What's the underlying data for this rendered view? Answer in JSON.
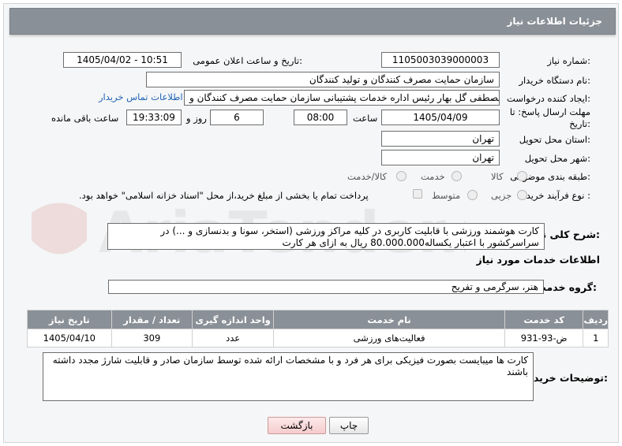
{
  "header": {
    "title": "جزئیات اطلاعات نیاز"
  },
  "form": {
    "need_number_label": "شماره نیاز:",
    "need_number": "1105003039000003",
    "announce_label": "تاریخ و ساعت اعلان عمومی:",
    "announce_value": "1405/04/02 - 10:51",
    "buyer_org_label": "نام دستگاه خریدار:",
    "buyer_org": "سازمان حمایت مصرف کنندگان و تولید کنندگان",
    "creator_label": "ایجاد کننده درخواست:",
    "creator": "مصطفی گل بهار رئیس اداره خدمات پشتیبانی سازمان حمایت مصرف کنندگان و",
    "contact_link": "اطلاعات تماس خریدار",
    "deadline_label": "مهلت ارسال پاسخ: تا تاریخ:",
    "deadline_date": "1405/04/09",
    "time_label": "ساعت",
    "deadline_time": "08:00",
    "days_value": "6",
    "days_label": "روز و",
    "remaining_time": "19:33:09",
    "remaining_label": "ساعت باقی مانده",
    "province_label": "استان محل تحویل:",
    "province": "تهران",
    "city_label": "شهر محل تحویل:",
    "city": "تهران",
    "category_label": "طبقه بندی موضوعی:",
    "category_options": [
      "کالا",
      "خدمت",
      "کالا/خدمت"
    ],
    "purchase_type_label": "نوع فرآیند خرید :",
    "purchase_options": [
      "جزیی",
      "متوسط"
    ],
    "payment_note": "پرداخت تمام یا بخشی از مبلغ خرید،از محل \"اسناد خزانه اسلامی\" خواهد بود."
  },
  "description": {
    "label": "شرح کلی نیاز:",
    "text": "کارت هوشمند ورزشی با قابلیت کاربری در کلیه مراکز ورزشی (استخر، سونا و بدنسازی و ...) در سراسرکشور با اعتبار یکساله80.000.000 ریال به ازای هر کارت"
  },
  "services": {
    "section_title": "اطلاعات خدمات مورد نیاز",
    "group_label": "گروه خدمت:",
    "group_value": "هنر، سرگرمی و تفریح",
    "columns": [
      "ردیف",
      "کد خدمت",
      "نام خدمت",
      "واحد اندازه گیری",
      "تعداد / مقدار",
      "تاریخ نیاز"
    ],
    "rows": [
      [
        "1",
        "ض-93-931",
        "فعالیت‌های ورزشی",
        "عدد",
        "309",
        "1405/04/10"
      ]
    ]
  },
  "buyer_notes": {
    "label": "توضیحات خریدار:",
    "text": "کارت ها میبایست بصورت فیزیکی برای هر فرد و با مشخصات  ارائه شده توسط سازمان صادر و قابلیت شارژ مجدد داشته باشند"
  },
  "buttons": {
    "print": "چاپ",
    "back": "بازگشت"
  },
  "colors": {
    "header_bg": "#8a9097",
    "link": "#1f63b5",
    "back_button": "#f5cccc"
  },
  "watermark": {
    "text": "AriaTender.net"
  }
}
